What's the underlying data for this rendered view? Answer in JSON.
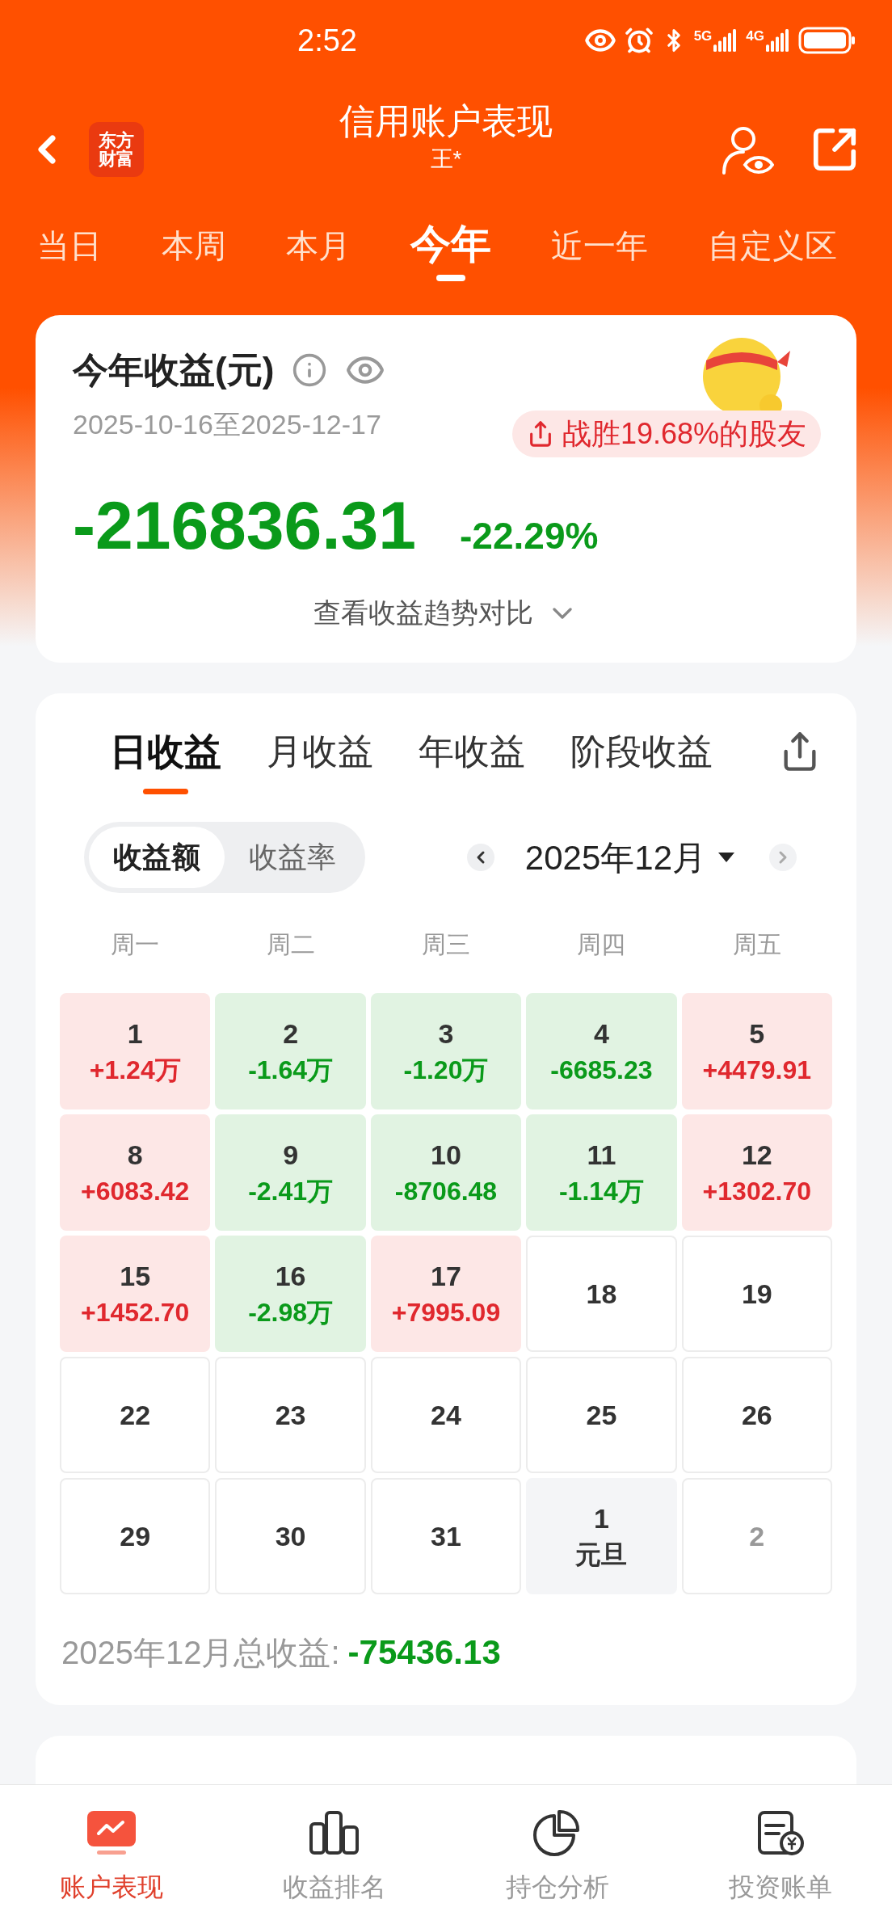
{
  "status_bar": {
    "time": "2:52",
    "networks": [
      "5G",
      "4G"
    ]
  },
  "header": {
    "logo_lines": [
      "东方",
      "财富"
    ],
    "title": "信用账户表现",
    "subtitle": "王*"
  },
  "period_tabs": [
    {
      "label": "当日",
      "selected": false
    },
    {
      "label": "本周",
      "selected": false
    },
    {
      "label": "本月",
      "selected": false
    },
    {
      "label": "今年",
      "selected": true
    },
    {
      "label": "近一年",
      "selected": false
    },
    {
      "label": "自定义区",
      "selected": false
    }
  ],
  "summary": {
    "title": "今年收益(元)",
    "date_range": "2025-10-16至2025-12-17",
    "rank_badge": "战胜19.68%的股友",
    "amount": "-216836.31",
    "rate": "-22.29%",
    "trend_link": "查看收益趋势对比"
  },
  "profit_card": {
    "tabs": [
      {
        "label": "日收益",
        "selected": true
      },
      {
        "label": "月收益",
        "selected": false
      },
      {
        "label": "年收益",
        "selected": false
      },
      {
        "label": "阶段收益",
        "selected": false
      }
    ],
    "toggle": [
      {
        "label": "收益额",
        "selected": true
      },
      {
        "label": "收益率",
        "selected": false
      }
    ],
    "month": "2025年12月",
    "weekdays": [
      "周一",
      "周二",
      "周三",
      "周四",
      "周五"
    ],
    "days": [
      {
        "day": "1",
        "value": "+1.24万",
        "kind": "gain"
      },
      {
        "day": "2",
        "value": "-1.64万",
        "kind": "loss"
      },
      {
        "day": "3",
        "value": "-1.20万",
        "kind": "loss"
      },
      {
        "day": "4",
        "value": "-6685.23",
        "kind": "loss"
      },
      {
        "day": "5",
        "value": "+4479.91",
        "kind": "gain"
      },
      {
        "day": "8",
        "value": "+6083.42",
        "kind": "gain"
      },
      {
        "day": "9",
        "value": "-2.41万",
        "kind": "loss"
      },
      {
        "day": "10",
        "value": "-8706.48",
        "kind": "loss"
      },
      {
        "day": "11",
        "value": "-1.14万",
        "kind": "loss"
      },
      {
        "day": "12",
        "value": "+1302.70",
        "kind": "gain"
      },
      {
        "day": "15",
        "value": "+1452.70",
        "kind": "gain"
      },
      {
        "day": "16",
        "value": "-2.98万",
        "kind": "loss"
      },
      {
        "day": "17",
        "value": "+7995.09",
        "kind": "gain"
      },
      {
        "day": "18",
        "kind": "plain"
      },
      {
        "day": "19",
        "kind": "plain"
      },
      {
        "day": "22",
        "kind": "plain"
      },
      {
        "day": "23",
        "kind": "plain"
      },
      {
        "day": "24",
        "kind": "plain"
      },
      {
        "day": "25",
        "kind": "plain"
      },
      {
        "day": "26",
        "kind": "plain"
      },
      {
        "day": "29",
        "kind": "plain"
      },
      {
        "day": "30",
        "kind": "plain"
      },
      {
        "day": "31",
        "kind": "plain"
      },
      {
        "day": "1",
        "value": "元旦",
        "kind": "holiday"
      },
      {
        "day": "2",
        "kind": "other_month"
      }
    ],
    "total_label": "2025年12月总收益:",
    "total_value": "-75436.13"
  },
  "bottom_nav": [
    {
      "label": "账户表现",
      "selected": true
    },
    {
      "label": "收益排名",
      "selected": false
    },
    {
      "label": "持仓分析",
      "selected": false
    },
    {
      "label": "投资账单",
      "selected": false
    }
  ]
}
